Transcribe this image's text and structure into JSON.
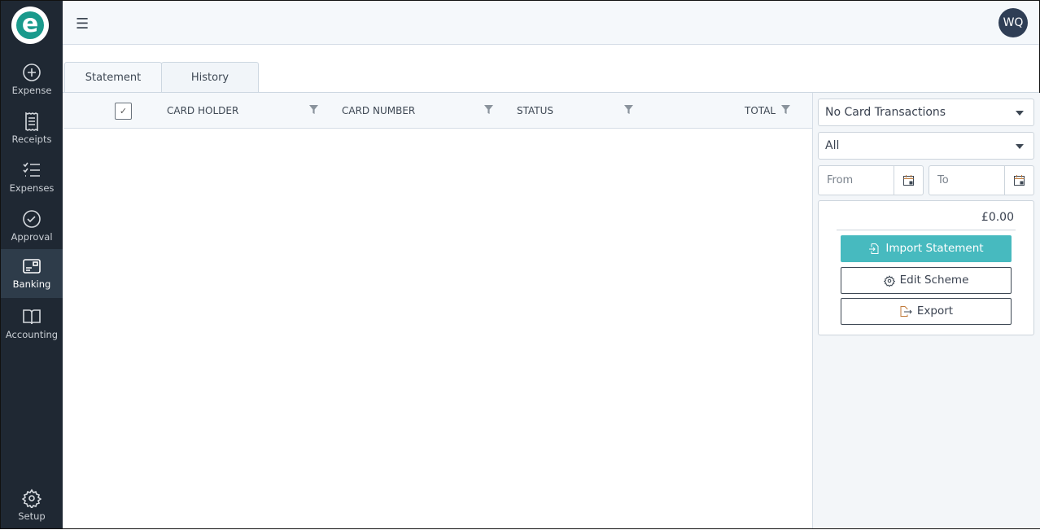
{
  "sidebar": {
    "logo": "e",
    "items": [
      {
        "label": "Expense",
        "icon": "plus-circle-icon"
      },
      {
        "label": "Receipts",
        "icon": "receipt-icon"
      },
      {
        "label": "Expenses",
        "icon": "checklist-icon"
      },
      {
        "label": "Approval",
        "icon": "check-circle-icon"
      },
      {
        "label": "Banking",
        "icon": "bank-card-icon",
        "active": true
      },
      {
        "label": "Accounting",
        "icon": "book-icon"
      }
    ],
    "setup": "Setup"
  },
  "header": {
    "avatar": "WQ"
  },
  "tabs": [
    {
      "label": "Statement",
      "active": true
    },
    {
      "label": "History"
    }
  ],
  "table": {
    "columns": [
      "CARD HOLDER",
      "CARD NUMBER",
      "STATUS",
      "TOTAL"
    ]
  },
  "panel": {
    "card_select": "No Card Transactions",
    "filter_select": "All",
    "from_placeholder": "From",
    "to_placeholder": "To",
    "total": "£0.00",
    "import_label": "Import Statement",
    "edit_label": "Edit Scheme",
    "export_label": "Export"
  },
  "colors": {
    "sidebar": "#1f2833",
    "accent": "#47babf",
    "logo": "#1a9a8c"
  }
}
